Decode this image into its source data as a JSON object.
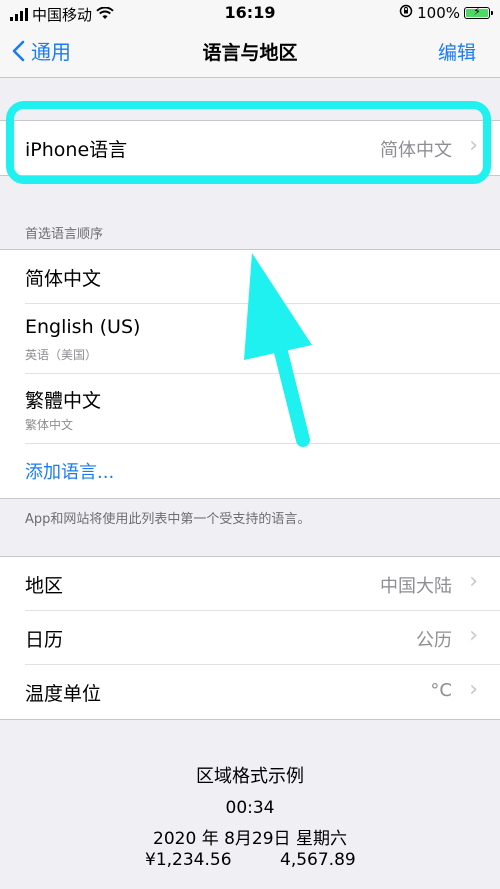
{
  "status_bar": {
    "carrier": "中国移动",
    "time": "16:19",
    "battery_percent": "100%"
  },
  "nav": {
    "back_label": "通用",
    "title": "语言与地区",
    "edit_label": "编辑"
  },
  "iphone_language": {
    "label": "iPhone语言",
    "value": "简体中文"
  },
  "preferred_order": {
    "header": "首选语言顺序",
    "languages": [
      {
        "name": "简体中文",
        "sub": ""
      },
      {
        "name": "English (US)",
        "sub": "英语（美国）"
      },
      {
        "name": "繁體中文",
        "sub": "繁体中文"
      }
    ],
    "add_label": "添加语言...",
    "footer": "App和网站将使用此列表中第一个受支持的语言。"
  },
  "region_settings": [
    {
      "label": "地区",
      "value": "中国大陆"
    },
    {
      "label": "日历",
      "value": "公历"
    },
    {
      "label": "温度单位",
      "value": "°C"
    }
  ],
  "format_example": {
    "title": "区域格式示例",
    "time": "00:34",
    "date": "2020 年 8月29日 星期六",
    "number1": "¥1,234.56",
    "number2": "4,567.89"
  },
  "colors": {
    "accent": "#1a7cf5",
    "highlight": "#1ff0f0",
    "background": "#efeff4"
  }
}
